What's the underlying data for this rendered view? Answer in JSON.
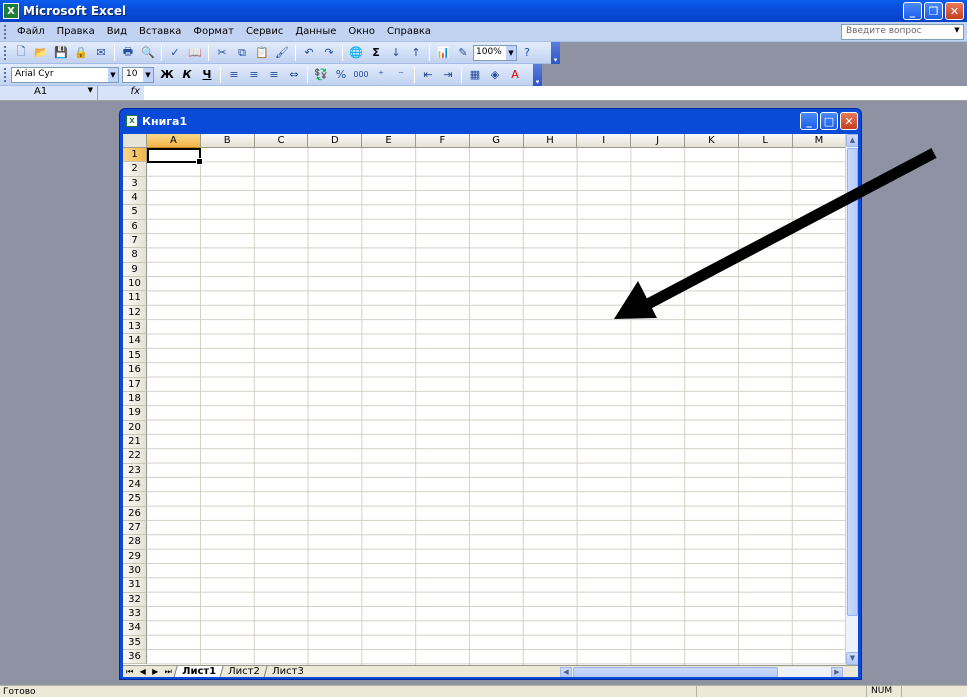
{
  "app": {
    "title": "Microsoft Excel",
    "icon_name": "excel-icon"
  },
  "menu": {
    "items": [
      {
        "label": "Файл"
      },
      {
        "label": "Правка"
      },
      {
        "label": "Вид"
      },
      {
        "label": "Вставка"
      },
      {
        "label": "Формат"
      },
      {
        "label": "Сервис"
      },
      {
        "label": "Данные"
      },
      {
        "label": "Окно"
      },
      {
        "label": "Справка"
      }
    ],
    "ask_placeholder": "Введите вопрос"
  },
  "toolbar": {
    "zoom": "100%",
    "sum_glyph": "Σ",
    "font_name": "Arial Cyr",
    "font_size": "10",
    "bold": "Ж",
    "italic": "К",
    "underline": "Ч",
    "percent": "%",
    "thousands": "000"
  },
  "formula_bar": {
    "name_box": "A1",
    "fx": "fx",
    "value": ""
  },
  "workbook": {
    "title": "Книга1",
    "columns": [
      "A",
      "B",
      "C",
      "D",
      "E",
      "F",
      "G",
      "H",
      "I",
      "J",
      "K",
      "L",
      "M"
    ],
    "rows": [
      "1",
      "2",
      "3",
      "4",
      "5",
      "6",
      "7",
      "8",
      "9",
      "10",
      "11",
      "12",
      "13",
      "14",
      "15",
      "16",
      "17",
      "18",
      "19",
      "20",
      "21",
      "22",
      "23",
      "24",
      "25",
      "26",
      "27",
      "28",
      "29",
      "30",
      "31",
      "32",
      "33",
      "34",
      "35",
      "36"
    ],
    "active_cell": "A1",
    "sheets": [
      {
        "label": "Лист1",
        "active": true
      },
      {
        "label": "Лист2",
        "active": false
      },
      {
        "label": "Лист3",
        "active": false
      }
    ]
  },
  "status": {
    "text": "Готово",
    "num": "NUM"
  },
  "colors": {
    "title_blue": "#0a4fdd",
    "toolbar_blue": "#c1d2f1",
    "active_header": "#f3b44a",
    "desktop": "#8e92a2"
  }
}
